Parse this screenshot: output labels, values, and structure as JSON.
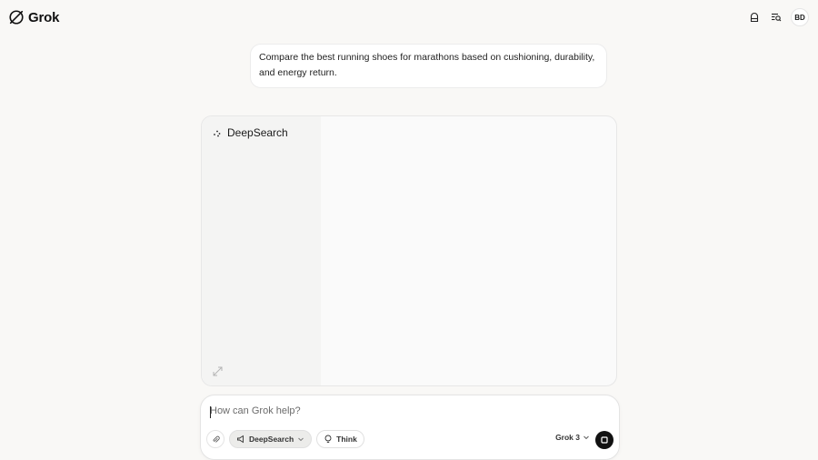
{
  "app": {
    "name": "Grok"
  },
  "header": {
    "avatar_initials": "BD"
  },
  "conversation": {
    "user_message": "Compare the best running shoes for marathons based on cushioning, durability, and energy return."
  },
  "deepsearch_panel": {
    "title": "DeepSearch"
  },
  "composer": {
    "placeholder": "How can Grok help?",
    "deepsearch_label": "DeepSearch",
    "think_label": "Think",
    "model_label": "Grok 3"
  },
  "icons": {
    "logo": "grok-logo-icon",
    "private": "ghost-icon",
    "history": "history-search-icon",
    "deepsearch": "sparkle-icon",
    "expand": "expand-icon",
    "attach": "paperclip-icon",
    "think": "lightbulb-icon",
    "model": "chevron-down-icon",
    "send": "send-icon"
  },
  "colors": {
    "background": "#f9f8f6",
    "accent": "#111111",
    "panel": "#fafafa"
  }
}
